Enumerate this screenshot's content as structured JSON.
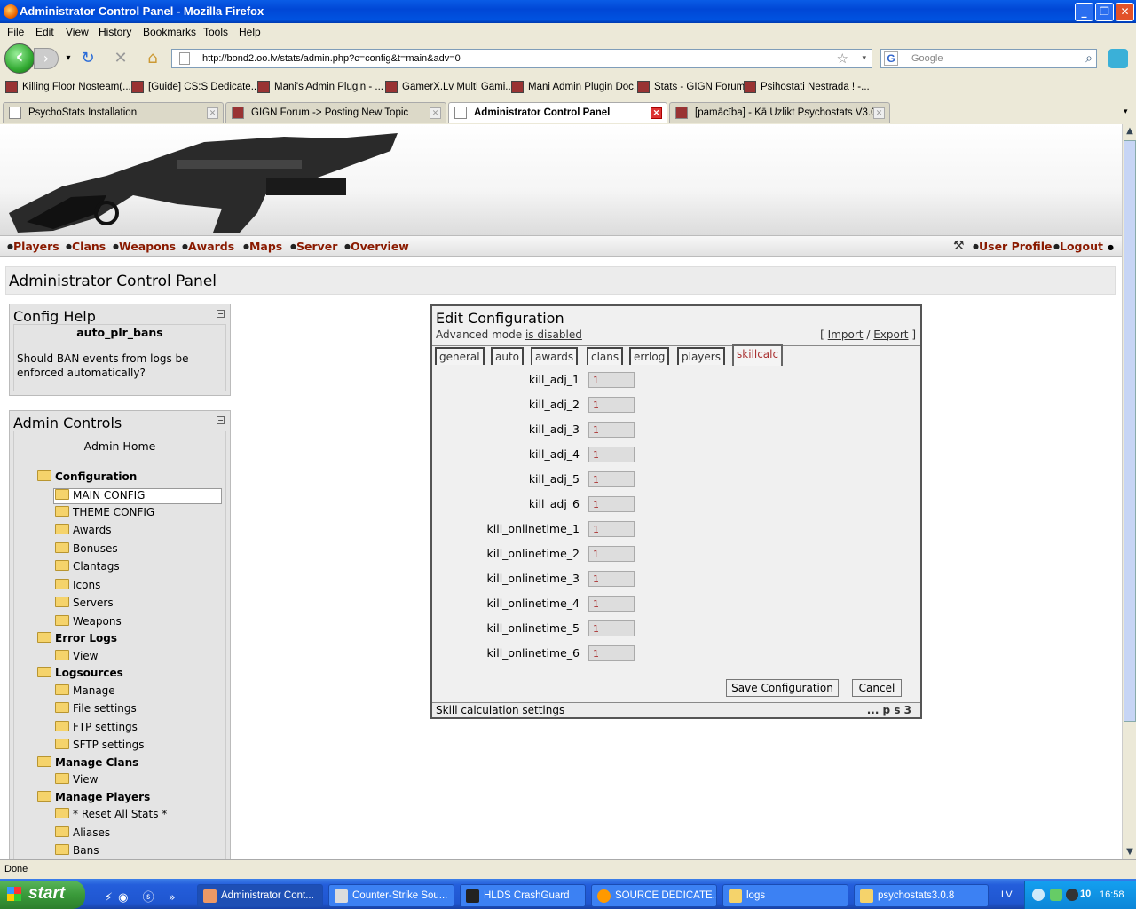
{
  "window": {
    "title": "Administrator Control Panel - Mozilla Firefox"
  },
  "menubar": [
    "File",
    "Edit",
    "View",
    "History",
    "Bookmarks",
    "Tools",
    "Help"
  ],
  "nav": {
    "url": "http://bond2.oo.lv/stats/admin.php?c=config&t=main&adv=0",
    "search_placeholder": "Google"
  },
  "bookmarks": [
    "Killing Floor Nosteam(...",
    "[Guide] CS:S Dedicate...",
    "Mani's Admin Plugin - ...",
    "GamerX.Lv Multi Gami...",
    "Mani Admin Plugin Doc...",
    "Stats - GIGN Forum",
    "Psihostati Nestrada ! -..."
  ],
  "tabs": [
    "PsychoStats Installation",
    "GIGN Forum -> Posting New Topic",
    "Administrator Control Panel",
    "[pamācība] - Kā Uzlikt Psychostats V3.0..."
  ],
  "sitenav": {
    "left": [
      "Players",
      "Clans",
      "Weapons",
      "Awards",
      "Maps",
      "Server",
      "Overview"
    ],
    "right": [
      "User Profile",
      "Logout"
    ]
  },
  "page_title": "Administrator Control Panel",
  "config_help": {
    "title": "Config Help",
    "key": "auto_plr_bans",
    "text": "Should BAN events from logs be enforced automatically?"
  },
  "admin_controls": {
    "title": "Admin Controls",
    "home": "Admin Home",
    "tree": [
      {
        "label": "Configuration",
        "level": 0
      },
      {
        "label": "MAIN CONFIG",
        "level": 1
      },
      {
        "label": "THEME CONFIG",
        "level": 1
      },
      {
        "label": "Awards",
        "level": 1
      },
      {
        "label": "Bonuses",
        "level": 1
      },
      {
        "label": "Clantags",
        "level": 1
      },
      {
        "label": "Icons",
        "level": 1
      },
      {
        "label": "Servers",
        "level": 1
      },
      {
        "label": "Weapons",
        "level": 1
      },
      {
        "label": "Error Logs",
        "level": 0
      },
      {
        "label": "View",
        "level": 1
      },
      {
        "label": "Logsources",
        "level": 0
      },
      {
        "label": "Manage",
        "level": 1
      },
      {
        "label": "File settings",
        "level": 1
      },
      {
        "label": "FTP settings",
        "level": 1
      },
      {
        "label": "SFTP settings",
        "level": 1
      },
      {
        "label": "Manage Clans",
        "level": 0
      },
      {
        "label": "View",
        "level": 1
      },
      {
        "label": "Manage Players",
        "level": 0
      },
      {
        "label": "* Reset All Stats *",
        "level": 1
      },
      {
        "label": "Aliases",
        "level": 1
      },
      {
        "label": "Bans",
        "level": 1
      }
    ]
  },
  "edit_config": {
    "title": "Edit Configuration",
    "adv_prefix": "Advanced mode",
    "adv_link": "is disabled",
    "import_export": {
      "open": "[",
      "import": "Import",
      "sep": "/",
      "export": "Export",
      "close": "]"
    },
    "tabs": [
      "general",
      "auto",
      "awards",
      "clans",
      "errlog",
      "players",
      "skillcalc"
    ],
    "active_tab": "skillcalc",
    "fields": [
      {
        "label": "kill_adj_1",
        "value": "1"
      },
      {
        "label": "kill_adj_2",
        "value": "1"
      },
      {
        "label": "kill_adj_3",
        "value": "1"
      },
      {
        "label": "kill_adj_4",
        "value": "1"
      },
      {
        "label": "kill_adj_5",
        "value": "1"
      },
      {
        "label": "kill_adj_6",
        "value": "1"
      },
      {
        "label": "kill_onlinetime_1",
        "value": "1"
      },
      {
        "label": "kill_onlinetime_2",
        "value": "1"
      },
      {
        "label": "kill_onlinetime_3",
        "value": "1"
      },
      {
        "label": "kill_onlinetime_4",
        "value": "1"
      },
      {
        "label": "kill_onlinetime_5",
        "value": "1"
      },
      {
        "label": "kill_onlinetime_6",
        "value": "1"
      }
    ],
    "save_label": "Save Configuration",
    "cancel_label": "Cancel",
    "footer_left": "Skill calculation settings",
    "footer_right": "... p s 3"
  },
  "status": "Done",
  "taskbar": {
    "start": "start",
    "tasks": [
      "Administrator Cont...",
      "Counter-Strike Sou...",
      "HLDS CrashGuard",
      "SOURCE DEDICATE...",
      "logs",
      "psychostats3.0.8"
    ],
    "lang": "LV",
    "tray_num": "10",
    "clock": "16:58"
  },
  "colors": {
    "accent_link": "#8a1a00",
    "title_bar": "#0a5ce6",
    "taskbar": "#245edb"
  }
}
